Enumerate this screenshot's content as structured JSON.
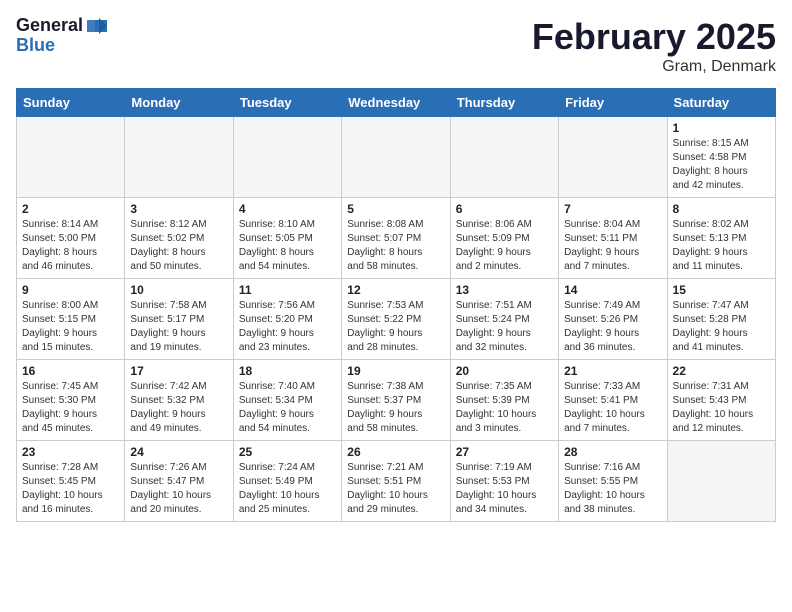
{
  "header": {
    "logo_line1": "General",
    "logo_line2": "Blue",
    "title": "February 2025",
    "subtitle": "Gram, Denmark"
  },
  "weekdays": [
    "Sunday",
    "Monday",
    "Tuesday",
    "Wednesday",
    "Thursday",
    "Friday",
    "Saturday"
  ],
  "weeks": [
    [
      {
        "day": "",
        "info": ""
      },
      {
        "day": "",
        "info": ""
      },
      {
        "day": "",
        "info": ""
      },
      {
        "day": "",
        "info": ""
      },
      {
        "day": "",
        "info": ""
      },
      {
        "day": "",
        "info": ""
      },
      {
        "day": "1",
        "info": "Sunrise: 8:15 AM\nSunset: 4:58 PM\nDaylight: 8 hours\nand 42 minutes."
      }
    ],
    [
      {
        "day": "2",
        "info": "Sunrise: 8:14 AM\nSunset: 5:00 PM\nDaylight: 8 hours\nand 46 minutes."
      },
      {
        "day": "3",
        "info": "Sunrise: 8:12 AM\nSunset: 5:02 PM\nDaylight: 8 hours\nand 50 minutes."
      },
      {
        "day": "4",
        "info": "Sunrise: 8:10 AM\nSunset: 5:05 PM\nDaylight: 8 hours\nand 54 minutes."
      },
      {
        "day": "5",
        "info": "Sunrise: 8:08 AM\nSunset: 5:07 PM\nDaylight: 8 hours\nand 58 minutes."
      },
      {
        "day": "6",
        "info": "Sunrise: 8:06 AM\nSunset: 5:09 PM\nDaylight: 9 hours\nand 2 minutes."
      },
      {
        "day": "7",
        "info": "Sunrise: 8:04 AM\nSunset: 5:11 PM\nDaylight: 9 hours\nand 7 minutes."
      },
      {
        "day": "8",
        "info": "Sunrise: 8:02 AM\nSunset: 5:13 PM\nDaylight: 9 hours\nand 11 minutes."
      }
    ],
    [
      {
        "day": "9",
        "info": "Sunrise: 8:00 AM\nSunset: 5:15 PM\nDaylight: 9 hours\nand 15 minutes."
      },
      {
        "day": "10",
        "info": "Sunrise: 7:58 AM\nSunset: 5:17 PM\nDaylight: 9 hours\nand 19 minutes."
      },
      {
        "day": "11",
        "info": "Sunrise: 7:56 AM\nSunset: 5:20 PM\nDaylight: 9 hours\nand 23 minutes."
      },
      {
        "day": "12",
        "info": "Sunrise: 7:53 AM\nSunset: 5:22 PM\nDaylight: 9 hours\nand 28 minutes."
      },
      {
        "day": "13",
        "info": "Sunrise: 7:51 AM\nSunset: 5:24 PM\nDaylight: 9 hours\nand 32 minutes."
      },
      {
        "day": "14",
        "info": "Sunrise: 7:49 AM\nSunset: 5:26 PM\nDaylight: 9 hours\nand 36 minutes."
      },
      {
        "day": "15",
        "info": "Sunrise: 7:47 AM\nSunset: 5:28 PM\nDaylight: 9 hours\nand 41 minutes."
      }
    ],
    [
      {
        "day": "16",
        "info": "Sunrise: 7:45 AM\nSunset: 5:30 PM\nDaylight: 9 hours\nand 45 minutes."
      },
      {
        "day": "17",
        "info": "Sunrise: 7:42 AM\nSunset: 5:32 PM\nDaylight: 9 hours\nand 49 minutes."
      },
      {
        "day": "18",
        "info": "Sunrise: 7:40 AM\nSunset: 5:34 PM\nDaylight: 9 hours\nand 54 minutes."
      },
      {
        "day": "19",
        "info": "Sunrise: 7:38 AM\nSunset: 5:37 PM\nDaylight: 9 hours\nand 58 minutes."
      },
      {
        "day": "20",
        "info": "Sunrise: 7:35 AM\nSunset: 5:39 PM\nDaylight: 10 hours\nand 3 minutes."
      },
      {
        "day": "21",
        "info": "Sunrise: 7:33 AM\nSunset: 5:41 PM\nDaylight: 10 hours\nand 7 minutes."
      },
      {
        "day": "22",
        "info": "Sunrise: 7:31 AM\nSunset: 5:43 PM\nDaylight: 10 hours\nand 12 minutes."
      }
    ],
    [
      {
        "day": "23",
        "info": "Sunrise: 7:28 AM\nSunset: 5:45 PM\nDaylight: 10 hours\nand 16 minutes."
      },
      {
        "day": "24",
        "info": "Sunrise: 7:26 AM\nSunset: 5:47 PM\nDaylight: 10 hours\nand 20 minutes."
      },
      {
        "day": "25",
        "info": "Sunrise: 7:24 AM\nSunset: 5:49 PM\nDaylight: 10 hours\nand 25 minutes."
      },
      {
        "day": "26",
        "info": "Sunrise: 7:21 AM\nSunset: 5:51 PM\nDaylight: 10 hours\nand 29 minutes."
      },
      {
        "day": "27",
        "info": "Sunrise: 7:19 AM\nSunset: 5:53 PM\nDaylight: 10 hours\nand 34 minutes."
      },
      {
        "day": "28",
        "info": "Sunrise: 7:16 AM\nSunset: 5:55 PM\nDaylight: 10 hours\nand 38 minutes."
      },
      {
        "day": "",
        "info": ""
      }
    ]
  ]
}
